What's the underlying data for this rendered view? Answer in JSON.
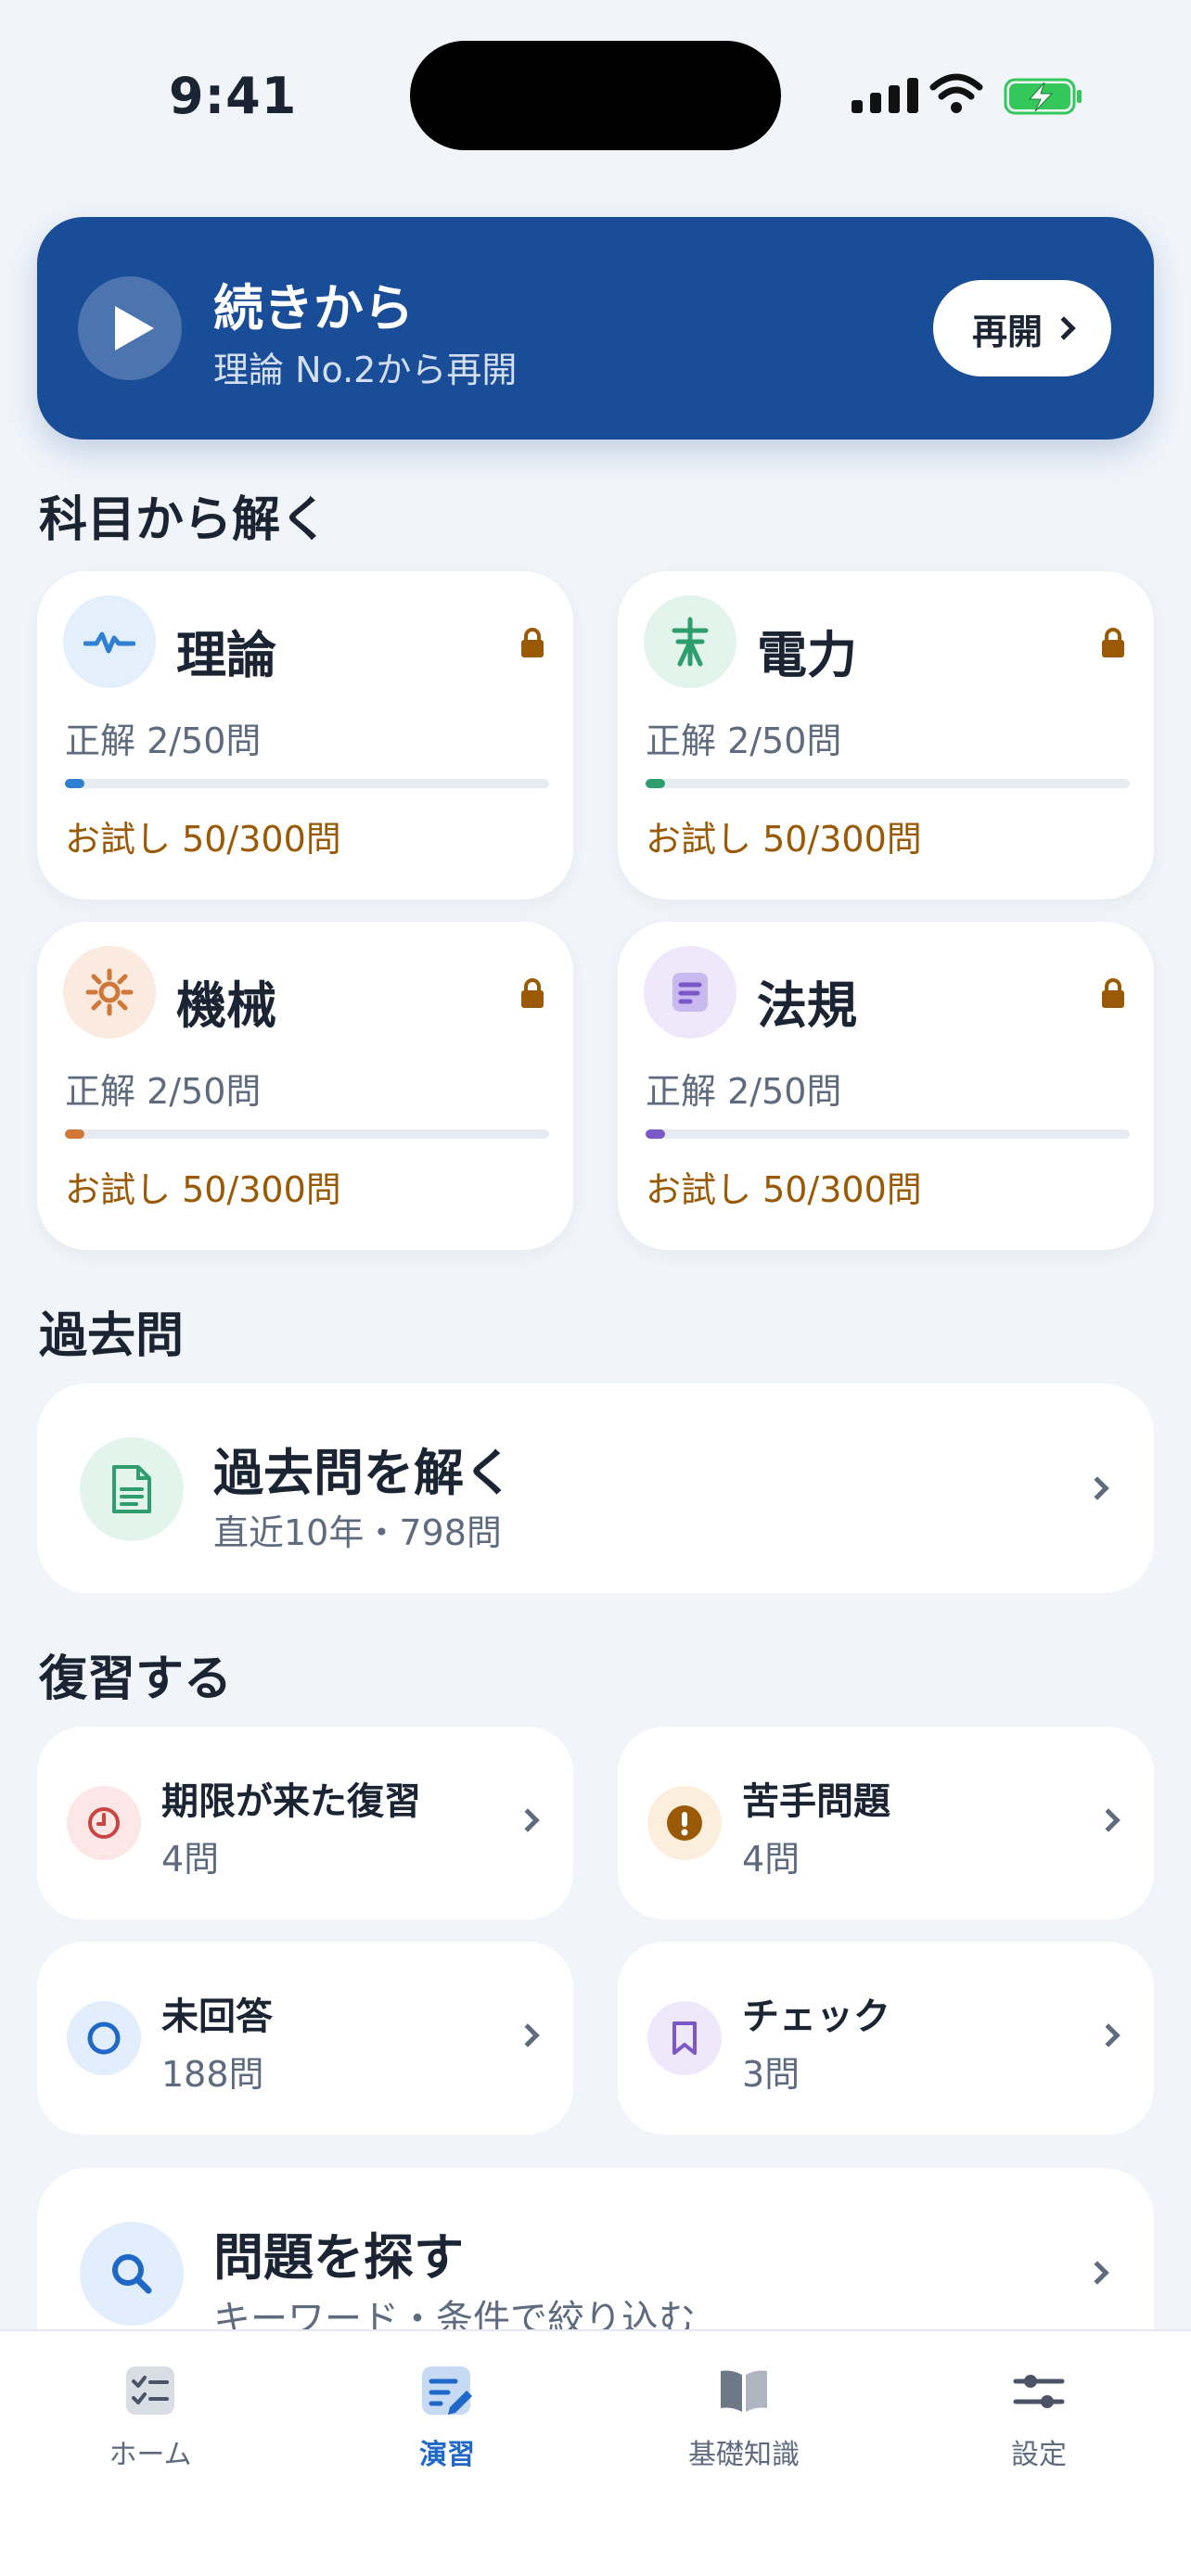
{
  "status_bar": {
    "time": "9:41"
  },
  "resume": {
    "title": "続きから",
    "subtitle": "理論 No.2から再開",
    "button_label": "再開"
  },
  "subjects_section": {
    "title": "科目から解く",
    "items": [
      {
        "name": "理論",
        "correct": "正解 2/50問",
        "trial": "お試し 50/300問",
        "progress": 0.04,
        "color": "#2F7FD2"
      },
      {
        "name": "電力",
        "correct": "正解 2/50問",
        "trial": "お試し 50/300問",
        "progress": 0.04,
        "color": "#2E9E6E"
      },
      {
        "name": "機械",
        "correct": "正解 2/50問",
        "trial": "お試し 50/300問",
        "progress": 0.04,
        "color": "#D0783A"
      },
      {
        "name": "法規",
        "correct": "正解 2/50問",
        "trial": "お試し 50/300問",
        "progress": 0.04,
        "color": "#7B58C8"
      }
    ]
  },
  "past_section": {
    "title": "過去問",
    "card_title": "過去問を解く",
    "card_sub": "直近10年・798問"
  },
  "review_section": {
    "title": "復習する",
    "items": [
      {
        "label": "期限が来た復習",
        "count": "4問"
      },
      {
        "label": "苦手問題",
        "count": "4問"
      },
      {
        "label": "未回答",
        "count": "188問"
      },
      {
        "label": "チェック",
        "count": "3問"
      }
    ]
  },
  "search": {
    "title": "問題を探す",
    "subtitle": "キーワード・条件で絞り込む"
  },
  "tabs": [
    {
      "label": "ホーム"
    },
    {
      "label": "演習"
    },
    {
      "label": "基礎知識"
    },
    {
      "label": "設定"
    }
  ],
  "colors": {
    "primary": "#1A4D98",
    "accent": "#1F68C8",
    "trial": "#9A5A05",
    "background": "#F1F5FA"
  }
}
